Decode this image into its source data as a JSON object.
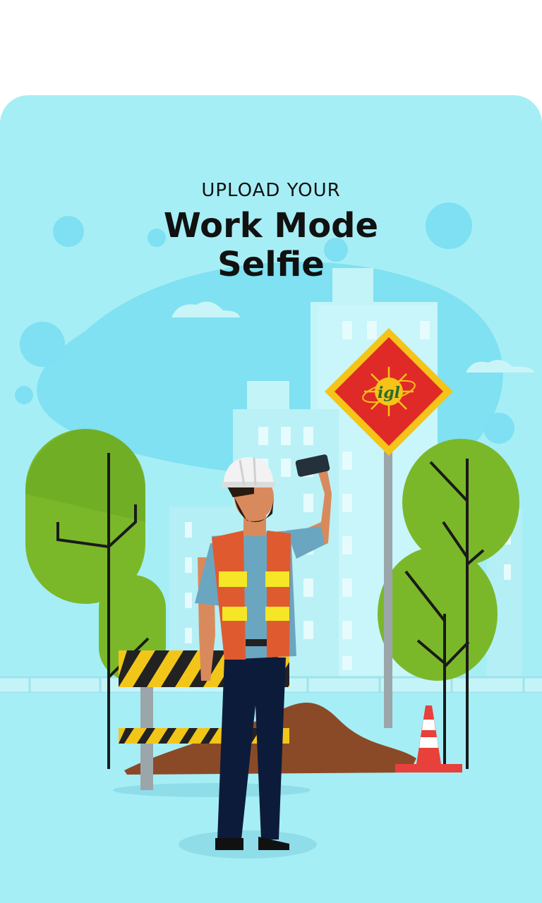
{
  "header": {
    "subtitle": "UPLOAD YOUR",
    "title_line1": "Work Mode",
    "title_line2": "Selfie"
  },
  "sign": {
    "logo_text": "igl"
  },
  "colors": {
    "background": "#a6eef5",
    "building": "#c3f4f8",
    "tree": "#7ab82a",
    "sign_red": "#e02a27",
    "sign_yellow": "#f6c319",
    "vest": "#e05a30",
    "stripe": "#f5e626"
  }
}
